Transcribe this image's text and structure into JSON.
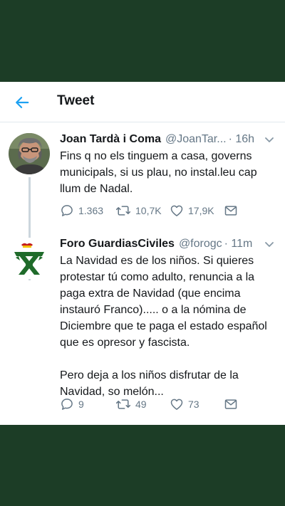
{
  "header": {
    "title": "Tweet",
    "back_icon": "arrow-left-icon",
    "accent": "#1da1f2"
  },
  "tweets": [
    {
      "name": "Joan Tardà i Coma",
      "handle": "@JoanTar...",
      "time": "· 16h",
      "text": "Fins q no els tinguem a casa, governs municipals, si us plau, no instal.leu  cap llum de Nadal.",
      "replies": "1.363",
      "retweets": "10,7K",
      "likes": "17,9K"
    },
    {
      "name": "Foro GuardiasCiviles",
      "handle": "@forogc",
      "time": "· 11m",
      "text": "La Navidad es de los niños. Si quieres protestar tú como adulto, renuncia a la paga extra de Navidad (que encima instauró Franco)..... o a la nómina de Diciembre que te paga el estado español que es opresor y fascista.\n\nPero deja a los niños disfrutar de la Navidad, so melón...",
      "replies": "9",
      "retweets": "49",
      "likes": "73"
    }
  ],
  "colors": {
    "background_band": "#1c3d26",
    "text_secondary": "#657786",
    "thread_line": "#ccd6dd"
  }
}
